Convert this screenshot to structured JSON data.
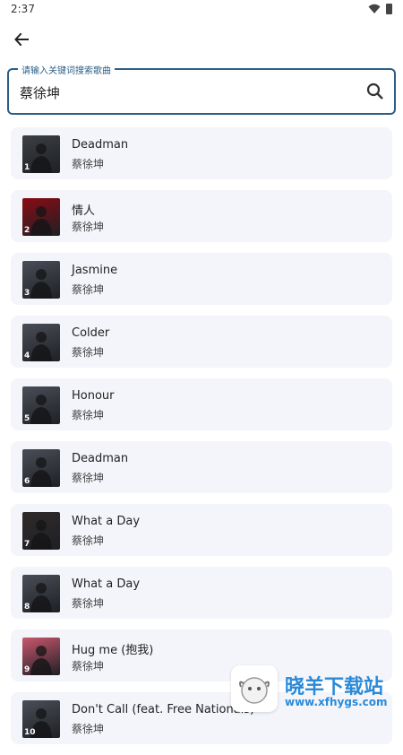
{
  "status": {
    "time": "2:37"
  },
  "search": {
    "label": "请输入关键词搜索歌曲",
    "value": "蔡徐坤"
  },
  "songs": [
    {
      "num": "1",
      "title": "Deadman",
      "artist": "蔡徐坤",
      "thumb": "#3c3f44"
    },
    {
      "num": "2",
      "title": "情人",
      "artist": "蔡徐坤",
      "thumb": "#8a0b14"
    },
    {
      "num": "3",
      "title": "Jasmine",
      "artist": "蔡徐坤",
      "thumb": "#4a4e57"
    },
    {
      "num": "4",
      "title": "Colder",
      "artist": "蔡徐坤",
      "thumb": "#4a4e57"
    },
    {
      "num": "5",
      "title": "Honour",
      "artist": "蔡徐坤",
      "thumb": "#4a4e57"
    },
    {
      "num": "6",
      "title": "Deadman",
      "artist": "蔡徐坤",
      "thumb": "#4a4e57"
    },
    {
      "num": "7",
      "title": "What a Day",
      "artist": "蔡徐坤",
      "thumb": "#2f2a2a"
    },
    {
      "num": "8",
      "title": "What a Day",
      "artist": "蔡徐坤",
      "thumb": "#4a4e57"
    },
    {
      "num": "9",
      "title": "Hug me (抱我)",
      "artist": "蔡徐坤",
      "thumb": "#c9576e"
    },
    {
      "num": "10",
      "title": "Don't Call (feat. Free Nationals)",
      "artist": "蔡徐坤",
      "thumb": "#4a4e57"
    }
  ],
  "watermark": {
    "title": "晓羊下载站",
    "url": "www.xfhygs.com"
  }
}
